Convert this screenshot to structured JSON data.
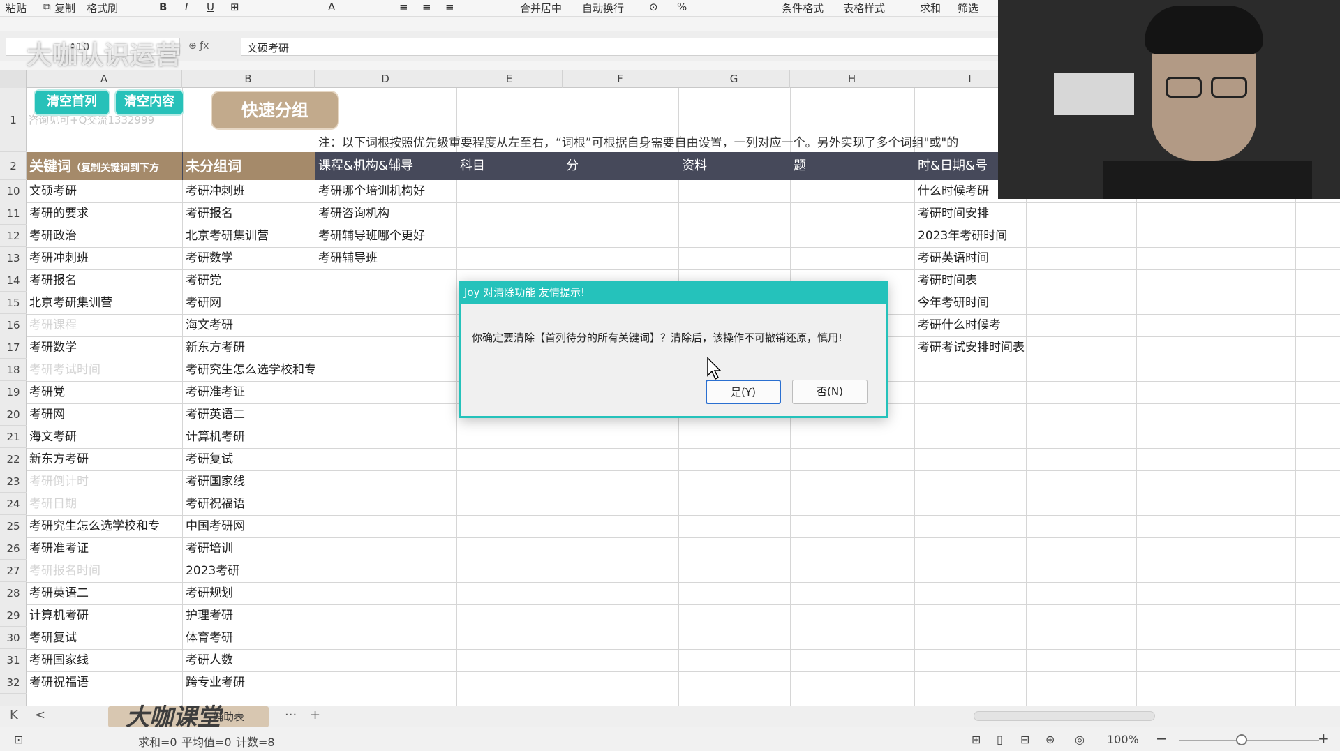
{
  "ribbon": {
    "items": [
      "粘贴",
      "复制",
      "格式刷",
      "合并居中",
      "自动换行",
      "条件格式",
      "表格样式",
      "求和",
      "筛选"
    ]
  },
  "formula_bar": {
    "name_box": "A10",
    "fx_icons": "⊕ ƒx",
    "content": "文硕考研",
    "brand_overlay": "大咖认识运营"
  },
  "columns": [
    "A",
    "B",
    "D",
    "E",
    "F",
    "G",
    "H",
    "I"
  ],
  "row1": {
    "btn_clear_first": "清空首列",
    "btn_clear_content": "清空内容",
    "btn_quick_group": "快速分组",
    "faint_note": "咨询见可+Q交流1332999",
    "note": "注：以下词根按照优先级重要程度从左至右，“词根”可根据自身需要自由设置，一列对应一个。另外实现了多个词组\"或\"的"
  },
  "header_row": {
    "a_main": "关键词",
    "a_sub": "（复制关键词到下方",
    "b": "未分组词",
    "d": "课程&机构&辅导",
    "e": "科目",
    "f": "分",
    "g": "资料",
    "h": "题",
    "i": "时&日期&号"
  },
  "rows": [
    {
      "num": "1"
    },
    {
      "num": "2"
    },
    {
      "num": "10",
      "a": "文硕考研",
      "b": "考研冲刺班",
      "d": "考研哪个培训机构好",
      "i": "什么时候考研"
    },
    {
      "num": "11",
      "a": "考研的要求",
      "b": "考研报名",
      "d": "考研咨询机构",
      "i": "考研时间安排"
    },
    {
      "num": "12",
      "a": "考研政治",
      "b": "北京考研集训营",
      "d": "考研辅导班哪个更好",
      "i": "2023年考研时间"
    },
    {
      "num": "13",
      "a": "考研冲刺班",
      "b": "考研数学",
      "d": "考研辅导班",
      "i": "考研英语时间"
    },
    {
      "num": "14",
      "a": "考研报名",
      "b": "考研党",
      "d": "",
      "i": "考研时间表"
    },
    {
      "num": "15",
      "a": "北京考研集训营",
      "b": "考研网",
      "d": "",
      "i": "今年考研时间"
    },
    {
      "num": "16",
      "a": "考研课程",
      "a_faded": true,
      "b": "海文考研",
      "d": "",
      "i": "考研什么时候考"
    },
    {
      "num": "17",
      "a": "考研数学",
      "b": "新东方考研",
      "d": "",
      "i": "考研考试安排时间表"
    },
    {
      "num": "18",
      "a": "考研考试时间",
      "a_faded": true,
      "b": "考研究生怎么选学校和专",
      "d": "",
      "i": ""
    },
    {
      "num": "19",
      "a": "考研党",
      "b": "考研准考证",
      "d": "",
      "i": ""
    },
    {
      "num": "20",
      "a": "考研网",
      "b": "考研英语二",
      "d": "",
      "i": ""
    },
    {
      "num": "21",
      "a": "海文考研",
      "b": "计算机考研",
      "d": "",
      "i": ""
    },
    {
      "num": "22",
      "a": "新东方考研",
      "b": "考研复试",
      "d": "",
      "i": ""
    },
    {
      "num": "23",
      "a": "考研倒计时",
      "a_faded": true,
      "b": "考研国家线",
      "d": "",
      "i": ""
    },
    {
      "num": "24",
      "a": "考研日期",
      "a_faded": true,
      "b": "考研祝福语",
      "d": "",
      "i": ""
    },
    {
      "num": "25",
      "a": "考研究生怎么选学校和专",
      "b": "中国考研网",
      "d": "",
      "i": ""
    },
    {
      "num": "26",
      "a": "考研准考证",
      "b": "考研培训",
      "d": "",
      "i": ""
    },
    {
      "num": "27",
      "a": "考研报名时间",
      "a_faded": true,
      "b": "2023考研",
      "d": "",
      "i": ""
    },
    {
      "num": "28",
      "a": "考研英语二",
      "b": "考研规划",
      "d": "",
      "i": ""
    },
    {
      "num": "29",
      "a": "计算机考研",
      "b": "护理考研",
      "d": "",
      "i": ""
    },
    {
      "num": "30",
      "a": "考研复试",
      "b": "体育考研",
      "d": "",
      "i": ""
    },
    {
      "num": "31",
      "a": "考研国家线",
      "b": "考研人数",
      "d": "",
      "i": ""
    },
    {
      "num": "32",
      "a": "考研祝福语",
      "b": "跨专业考研",
      "d": "",
      "i": ""
    }
  ],
  "tabs": {
    "first": "K",
    "prev": "<",
    "more": "···",
    "add": "+",
    "active": "辅助表"
  },
  "logo_overlay": "大咖课堂",
  "status": {
    "sum": "求和=0",
    "avg": "平均值=0",
    "count": "计数=8",
    "zoom": "100%",
    "zoom_out": "−",
    "zoom_in": "+"
  },
  "dialog": {
    "title": "Joy 对清除功能 友情提示!",
    "message": "你确定要清除【首列待分的所有关键词】？清除后，该操作不可撤销还原，慎用!",
    "yes": "是(Y)",
    "no": "否(N)"
  },
  "colors": {
    "teal": "#25c2bb",
    "brown": "#a58a6a",
    "header_dark": "#46495a"
  }
}
